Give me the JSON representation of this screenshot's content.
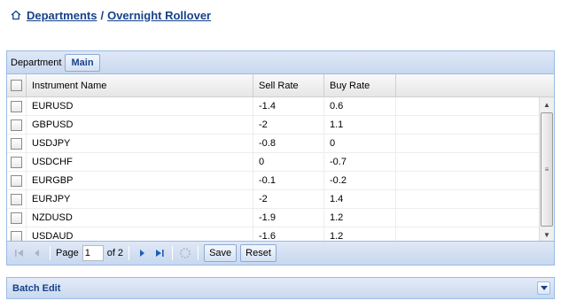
{
  "breadcrumb": {
    "home_icon": "home-icon",
    "items": [
      "Departments",
      "Overnight Rollover"
    ],
    "separator": "/"
  },
  "toolbar": {
    "department_label": "Department",
    "department_value": "Main"
  },
  "grid": {
    "columns": [
      "Instrument Name",
      "Sell Rate",
      "Buy Rate"
    ],
    "rows": [
      {
        "name": "EURUSD",
        "sell": "-1.4",
        "buy": "0.6"
      },
      {
        "name": "GBPUSD",
        "sell": "-2",
        "buy": "1.1"
      },
      {
        "name": "USDJPY",
        "sell": "-0.8",
        "buy": "0"
      },
      {
        "name": "USDCHF",
        "sell": "0",
        "buy": "-0.7"
      },
      {
        "name": "EURGBP",
        "sell": "-0.1",
        "buy": "-0.2"
      },
      {
        "name": "EURJPY",
        "sell": "-2",
        "buy": "1.4"
      },
      {
        "name": "NZDUSD",
        "sell": "-1.9",
        "buy": "1.2"
      },
      {
        "name": "USDAUD",
        "sell": "-1.6",
        "buy": "1.2"
      }
    ]
  },
  "pager": {
    "page_label": "Page",
    "current_page": "1",
    "of_label": "of 2",
    "save_label": "Save",
    "reset_label": "Reset"
  },
  "batch": {
    "title": "Batch Edit"
  },
  "colors": {
    "accent": "#15428b",
    "panel_border": "#99bbe8",
    "toolbar_bg": "#dfe8f6"
  }
}
